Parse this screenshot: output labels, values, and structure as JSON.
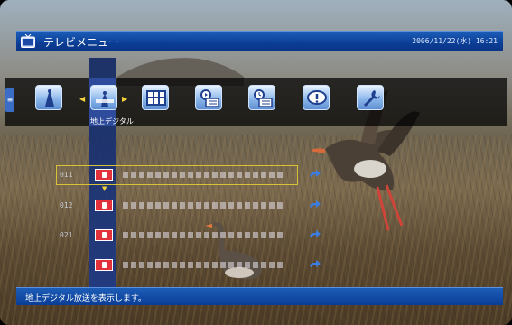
{
  "header": {
    "title": "テレビメニュー",
    "datetime": "2006/11/22(水) 16:21"
  },
  "menu": {
    "selected_label": "地上デジタル",
    "icons": [
      "digital-antenna-icon",
      "program-guide-icon",
      "record-list-icon",
      "timer-record-icon",
      "info-icon",
      "settings-wrench-icon"
    ]
  },
  "channels": [
    {
      "number": "011",
      "selected": true
    },
    {
      "number": "012"
    },
    {
      "number": "021"
    },
    {
      "number": ""
    }
  ],
  "status": {
    "message": "地上デジタル放送を表示します。"
  },
  "colors": {
    "bar_blue": "#0b3d95",
    "highlight": "#d8c23a",
    "channel_red": "#e2313a"
  }
}
